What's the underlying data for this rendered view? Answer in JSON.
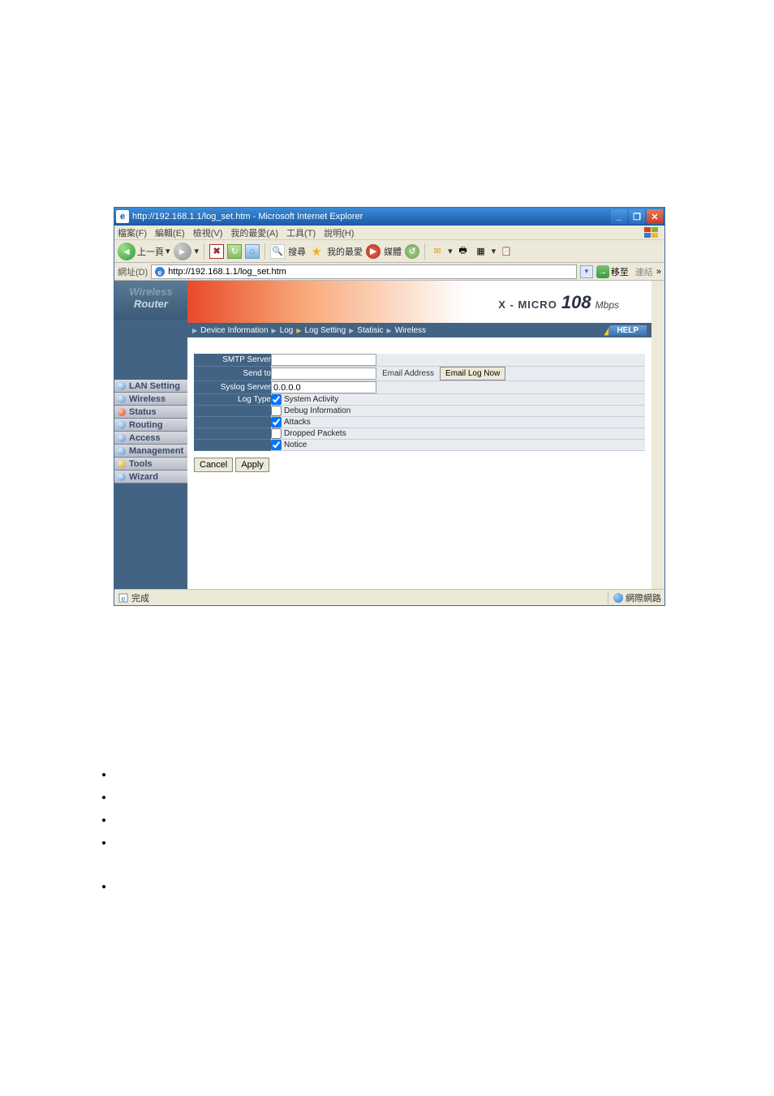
{
  "titlebar": {
    "text": "http://192.168.1.1/log_set.htm - Microsoft Internet Explorer"
  },
  "menubar": {
    "file": "檔案(F)",
    "edit": "編輯(E)",
    "view": "檢視(V)",
    "favorites": "我的最愛(A)",
    "tools": "工具(T)",
    "help": "說明(H)"
  },
  "toolbar": {
    "back": "上一頁",
    "search": "搜尋",
    "favorites": "我的最愛",
    "media": "媒體"
  },
  "addressbar": {
    "label": "網址(D)",
    "url": "http://192.168.1.1/log_set.htm",
    "go": "移至",
    "links": "連結"
  },
  "brand": {
    "line1": "Wireless",
    "line2": "Router"
  },
  "sidebar": {
    "items": [
      "LAN Setting",
      "Wireless",
      "Status",
      "Routing",
      "Access",
      "Management",
      "Tools",
      "Wizard"
    ]
  },
  "banner": {
    "prefix": "X - MICRO",
    "big": "108",
    "suffix": "Mbps"
  },
  "navtabs": {
    "t1": "Device Information",
    "t2": "Log",
    "t3": "Log Setting",
    "t4": "Statisic",
    "t5": "Wireless",
    "help": "HELP"
  },
  "form": {
    "smtp_label": "SMTP Server",
    "smtp_value": "",
    "sendto_label": "Send to",
    "sendto_value": "",
    "email_address_label": "Email Address",
    "email_btn": "Email Log Now",
    "syslog_label": "Syslog Server",
    "syslog_value": "0.0.0.0",
    "logtype_label": "Log Type",
    "opts": {
      "system": "System Activity",
      "debug": "Debug Information",
      "attacks": "Attacks",
      "dropped": "Dropped Packets",
      "notice": "Notice"
    },
    "cancel": "Cancel",
    "apply": "Apply"
  },
  "statusbar": {
    "done": "完成",
    "zone": "網際網路"
  }
}
